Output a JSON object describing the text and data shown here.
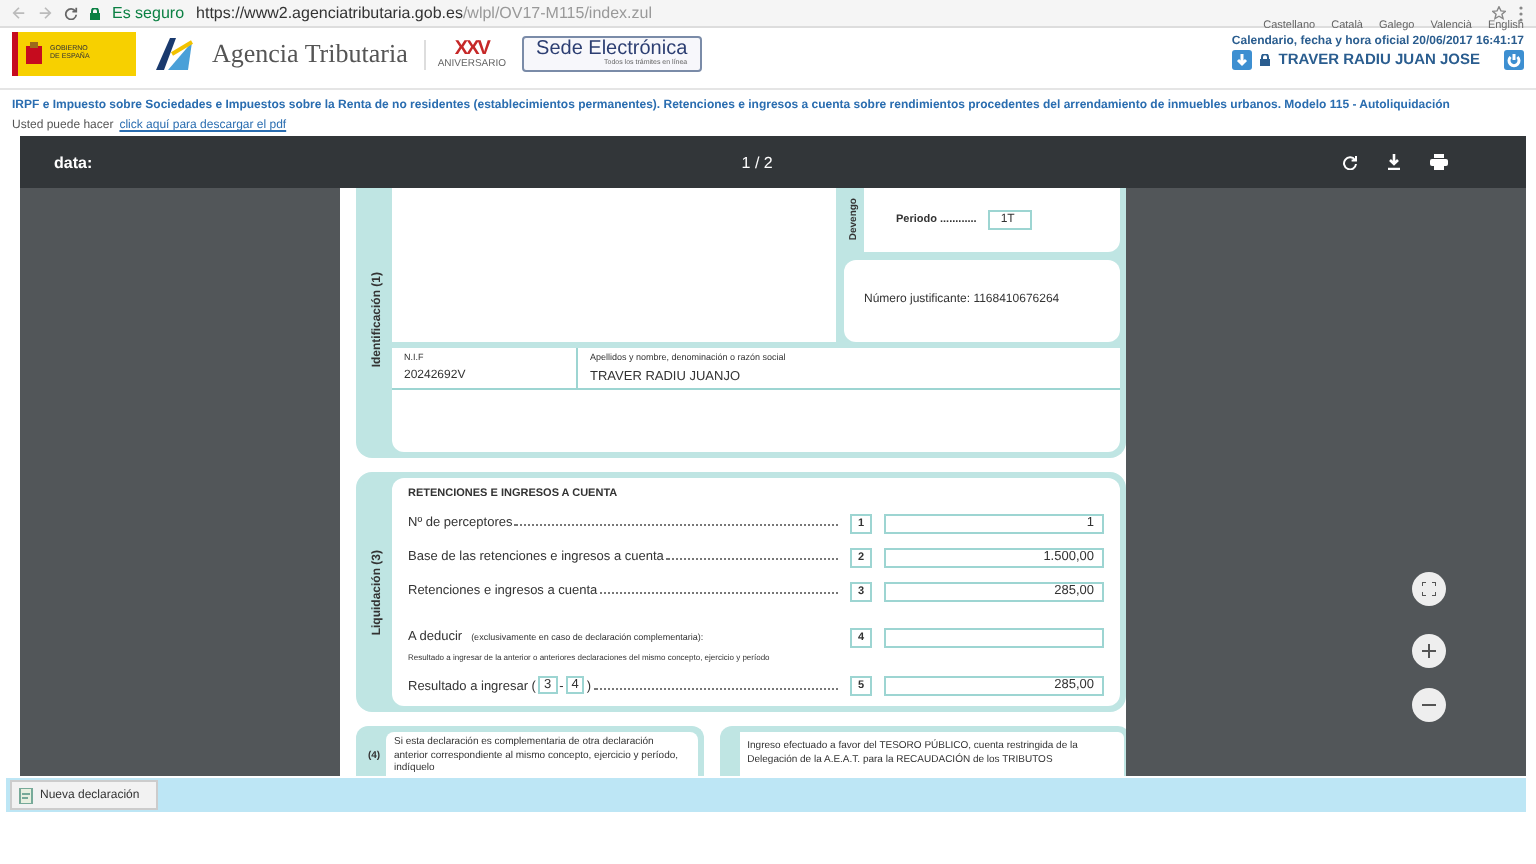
{
  "browser": {
    "secure_label": "Es seguro",
    "url_host": "https://www2.agenciatributaria.gob.es",
    "url_path": "/wlpl/OV17-M115/index.zul"
  },
  "header": {
    "gov_text": "GOBIERNO DE ESPAÑA",
    "agency": "Agencia Tributaria",
    "anniversary_number": "XXV",
    "anniversary_label": "ANIVERSARIO",
    "sede_title": "Sede Electrónica",
    "sede_subtitle": "Todos los trámites en línea",
    "languages": [
      "Castellano",
      "Català",
      "Galego",
      "Valencià",
      "English"
    ],
    "calendar": "Calendario, fecha y hora oficial 20/06/2017 16:41:17",
    "user": "TRAVER RADIU JUAN JOSE"
  },
  "title": "IRPF e Impuesto sobre Sociedades e Impuestos sobre la Renta de no residentes (establecimientos permanentes). Retenciones e ingresos a cuenta sobre rendimientos procedentes del arrendamiento de inmuebles urbanos. Modelo 115 - Autoliquidación",
  "download": {
    "prefix": "Usted puede hacer",
    "link": "click aquí para descargar el pdf"
  },
  "viewer": {
    "name": "data:",
    "page": "1 / 2"
  },
  "document": {
    "devengo_label": "Devengo",
    "periodo_label": "Periodo ............",
    "periodo_value": "1T",
    "justificante": "Número justificante: 1168410676264",
    "identificacion_label": "Identificación (1)",
    "nif_label": "N.I.F",
    "nif_value": "20242692V",
    "nombre_label": "Apellidos y nombre, denominación o razón social",
    "nombre_value": "TRAVER RADIU JUANJO",
    "liquidacion": {
      "label": "Liquidación (3)",
      "heading": "RETENCIONES E INGRESOS A CUENTA",
      "rows": [
        {
          "kind": "plain",
          "label": "Nº de perceptores",
          "number": "1",
          "value": "1"
        },
        {
          "kind": "plain",
          "label": "Base de las retenciones e ingresos a cuenta",
          "number": "2",
          "value": "1.500,00"
        },
        {
          "kind": "plain",
          "label": "Retenciones e ingresos a cuenta",
          "number": "3",
          "value": "285,00"
        },
        {
          "kind": "note",
          "label": "A deducir",
          "note": "(exclusivamente en caso de declaración complementaria):",
          "subnote": "Resultado a ingresar de la anterior o anteriores declaraciones del mismo concepto, ejercicio y período",
          "number": "4"
        },
        {
          "kind": "formula",
          "parts": [
            {
              "text": "Resultado a ingresar ("
            },
            {
              "ref": "3"
            },
            {
              "text": "-"
            },
            {
              "ref": "4"
            },
            {
              "text": ")"
            }
          ],
          "number": "5",
          "value": "285,00"
        }
      ]
    },
    "section4": {
      "label": "(4)",
      "text": "Si esta declaración es complementaria de otra declaración anterior correspondiente al mismo concepto, ejercicio y período, indíquelo",
      "payment": "Ingreso efectuado a favor del TESORO PÚBLICO, cuenta restringida de la Delegación de la A.E.A.T. para la RECAUDACIÓN de los TRIBUTOS"
    }
  },
  "bottom": {
    "button": "Nueva declaración"
  }
}
